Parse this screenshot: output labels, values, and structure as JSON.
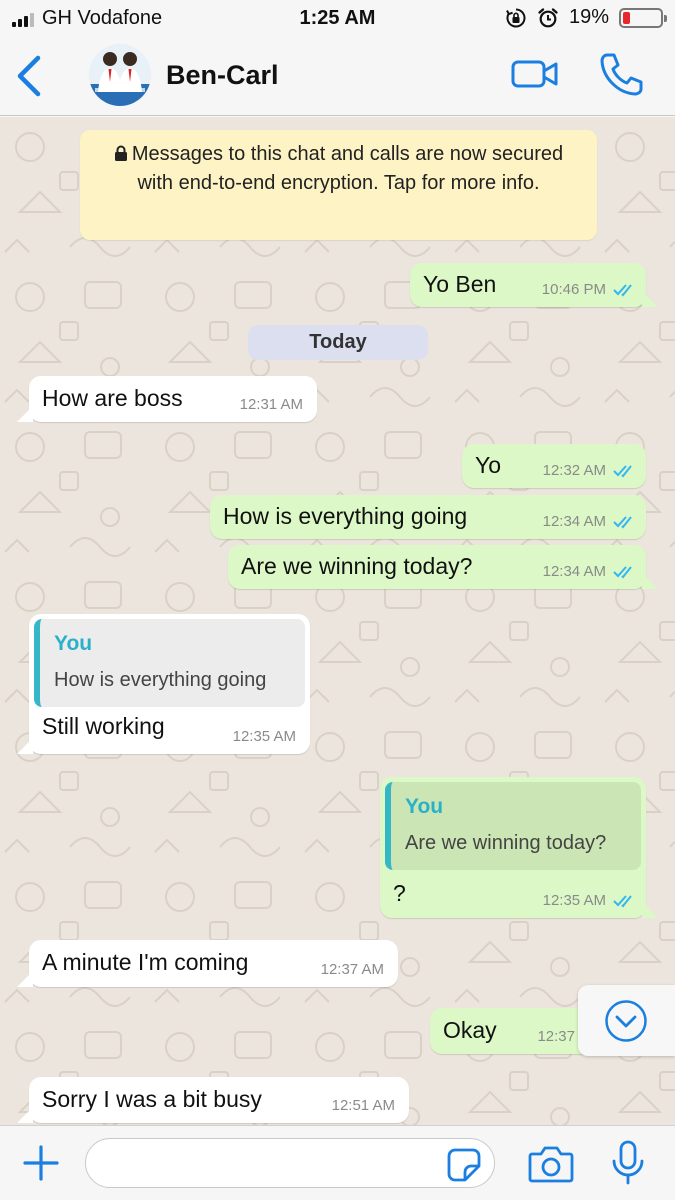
{
  "status_bar": {
    "carrier": "GH Vodafone",
    "time": "1:25 AM",
    "battery_percent": "19%",
    "battery_level": 0.19,
    "icons": [
      "signal-icon",
      "rotation-lock-icon",
      "alarm-icon",
      "battery-icon"
    ]
  },
  "header": {
    "contact_name": "Ben-Carl",
    "icons": [
      "back-chevron-icon",
      "video-call-icon",
      "phone-icon"
    ]
  },
  "chat": {
    "encryption_notice": "Messages to this chat and calls are now secured with end-to-end encryption. Tap for more info.",
    "day_separator": "Today",
    "messages": [
      {
        "dir": "out",
        "text": "Yo Ben",
        "time": "10:46 PM",
        "read": true
      },
      {
        "dir": "in",
        "text": "How are boss",
        "time": "12:31 AM"
      },
      {
        "dir": "out",
        "text": "Yo",
        "time": "12:32 AM",
        "read": true
      },
      {
        "dir": "out",
        "text": "How is everything going",
        "time": "12:34 AM",
        "read": true
      },
      {
        "dir": "out",
        "text": "Are we winning today?",
        "time": "12:34 AM",
        "read": true
      },
      {
        "dir": "in",
        "quote_author": "You",
        "quote_text": "How is everything going",
        "text": "Still working",
        "time": "12:35 AM"
      },
      {
        "dir": "out",
        "quote_author": "You",
        "quote_text": "Are we winning today?",
        "text": "?",
        "time": "12:35 AM",
        "read": true
      },
      {
        "dir": "in",
        "text": "A minute I'm coming",
        "time": "12:37 AM"
      },
      {
        "dir": "out",
        "text": "Okay",
        "time": "12:37"
      },
      {
        "dir": "in",
        "text": "Sorry I was a bit busy",
        "time": "12:51 AM"
      }
    ]
  },
  "input_bar": {
    "placeholder": "",
    "icons": [
      "plus-icon",
      "sticker-icon",
      "camera-icon",
      "microphone-icon"
    ]
  },
  "colors": {
    "accent": "#1a7fe0",
    "outgoing_bubble": "#dcf8c6",
    "incoming_bubble": "#ffffff",
    "chat_background": "#ece5dd",
    "encryption_banner": "#fdf3c5",
    "read_ticks": "#34b7f1",
    "quote_bar": "#35b7c8",
    "battery_low": "#e8262b"
  }
}
